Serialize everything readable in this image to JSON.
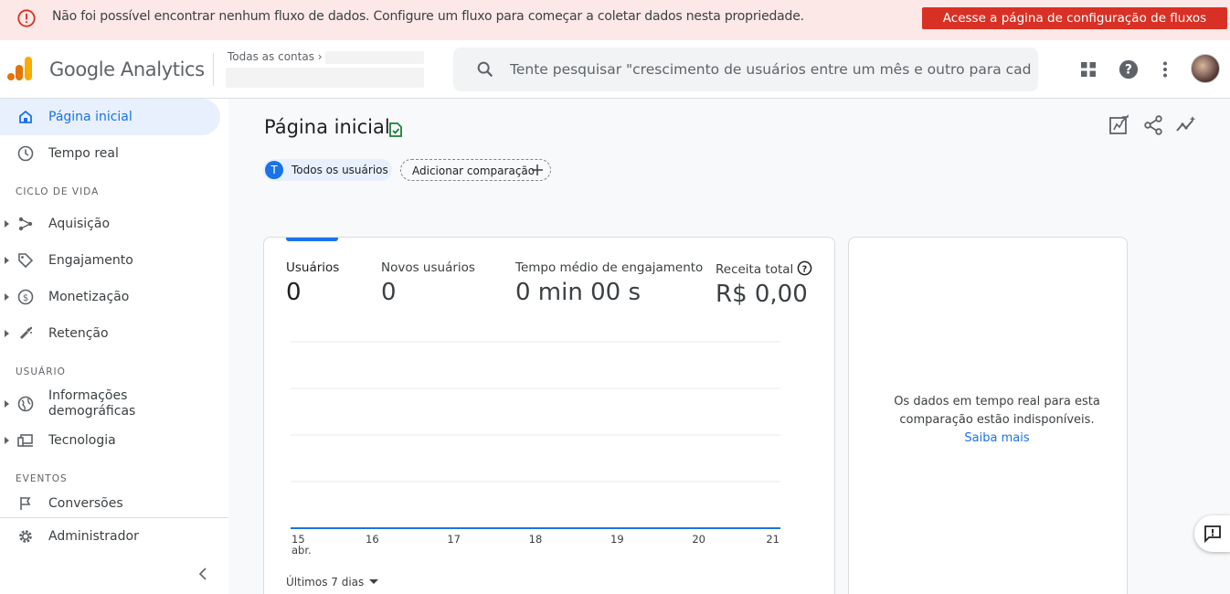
{
  "banner": {
    "message": "Não foi possível encontrar nenhum fluxo de dados. Configure um fluxo para começar a coletar dados nesta propriedade.",
    "cta_label": "Acesse a página de configuração de fluxos",
    "icon": "error-icon",
    "color": "#d93025"
  },
  "header": {
    "brand": "Google Analytics",
    "accounts_label": "Todas as contas",
    "search_placeholder": "Tente pesquisar \"crescimento de usuários entre um mês e outro para cad…",
    "icons": [
      "search-icon",
      "apps-icon",
      "help-icon",
      "more-vert-icon",
      "avatar"
    ]
  },
  "sidebar": {
    "items": [
      {
        "label": "Página inicial",
        "icon": "home-icon",
        "active": true
      },
      {
        "label": "Tempo real",
        "icon": "clock-icon"
      }
    ],
    "sections": [
      {
        "title": "CICLO DE VIDA",
        "items": [
          {
            "label": "Aquisição",
            "icon": "acquisition-icon"
          },
          {
            "label": "Engajamento",
            "icon": "tag-icon"
          },
          {
            "label": "Monetização",
            "icon": "dollar-icon"
          },
          {
            "label": "Retenção",
            "icon": "magnet-icon"
          }
        ]
      },
      {
        "title": "USUÁRIO",
        "items": [
          {
            "label": "Informações demográficas",
            "label_line1": "Informações",
            "label_line2": "demográficas",
            "icon": "globe-icon"
          },
          {
            "label": "Tecnologia",
            "icon": "devices-icon"
          }
        ]
      },
      {
        "title": "EVENTOS",
        "items": [
          {
            "label": "Conversões",
            "icon": "flag-icon"
          }
        ]
      }
    ],
    "admin_label": "Administrador"
  },
  "main": {
    "title": "Página inicial",
    "chips": {
      "all_users_badge": "T",
      "all_users": "Todos os usuários",
      "add_comparison": "Adicionar comparação"
    },
    "metrics": [
      {
        "label": "Usuários",
        "value": "0"
      },
      {
        "label": "Novos usuários",
        "value": "0"
      },
      {
        "label": "Tempo médio de engajamento",
        "value": "0 min 00 s"
      },
      {
        "label": "Receita total",
        "value": "R$ 0,00"
      }
    ],
    "date_range": "Últimos 7 dias",
    "realtime_message": "Os dados em tempo real para esta comparação estão indisponíveis.",
    "learn_more": "Saiba mais"
  },
  "chart_data": {
    "type": "line",
    "x": [
      "15 abr.",
      "16",
      "17",
      "18",
      "19",
      "20",
      "21"
    ],
    "x_tick_line1": [
      "15",
      "16",
      "17",
      "18",
      "19",
      "20",
      "21"
    ],
    "x_tick_line2": [
      "abr.",
      "",
      "",
      "",
      "",
      "",
      ""
    ],
    "series": [
      {
        "values": [
          0,
          0,
          0,
          0,
          0,
          0,
          0
        ]
      }
    ],
    "ylim": [
      0,
      4
    ],
    "grid": true,
    "color": "#1a73e8"
  }
}
